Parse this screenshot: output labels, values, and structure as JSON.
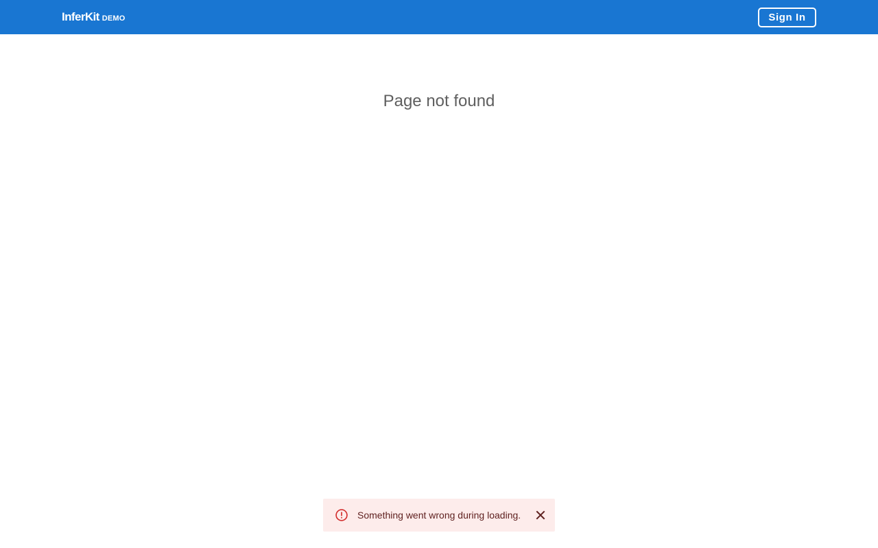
{
  "header": {
    "brand_name": "InferKit",
    "brand_tag": "DEMO",
    "signin_label": "Sign In",
    "bg_color": "#1976d2"
  },
  "main": {
    "title": "Page not found"
  },
  "toast": {
    "severity": "error",
    "icon": "error-outline-icon",
    "message": "Something went wrong during loading.",
    "close_icon": "close-icon",
    "bg_color": "#fdeceb",
    "accent_color": "#d32f2f"
  }
}
